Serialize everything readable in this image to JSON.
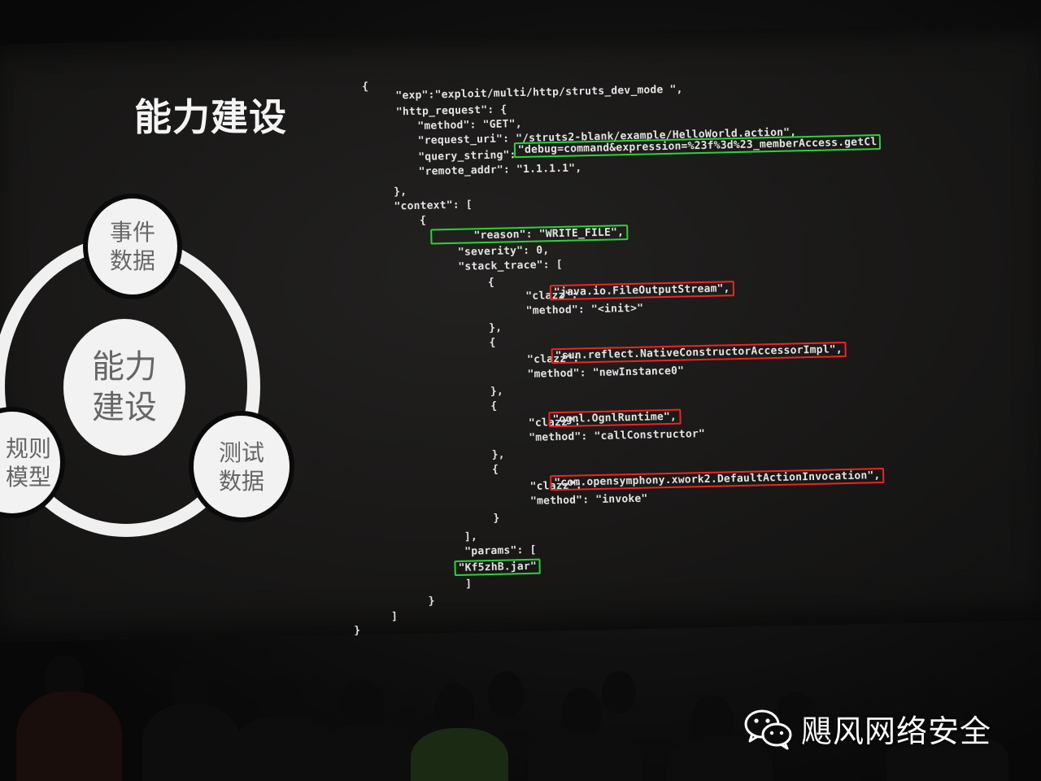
{
  "slide": {
    "title": "能力建设",
    "diagram": {
      "center": [
        "能力",
        "建设"
      ],
      "event_data": [
        "事件",
        "数据"
      ],
      "test_data": [
        "测试",
        "数据"
      ],
      "rule_model": [
        "规则",
        "模型"
      ]
    }
  },
  "code_lines": [
    "{",
    "  \"exp\":\"exploit/multi/http/struts_dev_mode \",",
    "  \"http_request\": {",
    "    \"method\": \"GET\",",
    "    \"request_uri\": \"/struts2-blank/example/HelloWorld.action\",",
    "    \"query_string\": ",
    "\"debug=command&expression=%23f%3d%23_memberAccess.getCl",
    "    \"remote_addr\": \"1.1.1.1\",",
    "  },",
    "  \"context\": [",
    "    {",
    "      \"reason\": \"WRITE_FILE\",",
    "      \"severity\": 0,",
    "      \"stack_trace\": [",
    "        {",
    "          \"clazz\": ",
    "\"java.io.FileOutputStream\",",
    "          \"method\": \"<init>\"",
    "        },",
    "        {",
    "          \"clazz\": ",
    "\"sun.reflect.NativeConstructorAccessorImpl\",",
    "          \"method\": \"newInstance0\"",
    "        },",
    "        {",
    "          \"clazz\": ",
    "\"ognl.OgnlRuntime\",",
    "          \"method\": \"callConstructor\"",
    "        },",
    "        {",
    "          \"clazz\": ",
    "\"com.opensymphony.xwork2.DefaultActionInvocation\",",
    "          \"method\": \"invoke\"",
    "        }",
    "      ],",
    "      \"params\": [",
    "\"Kf5zhB.jar\"",
    "      ]",
    "    }",
    "  ]",
    "}"
  ],
  "watermark": "飓风网络安全",
  "colors": {
    "highlight_green": "#2bd33a",
    "highlight_red": "#ee2424",
    "slide_text": "#f4f4f4"
  }
}
